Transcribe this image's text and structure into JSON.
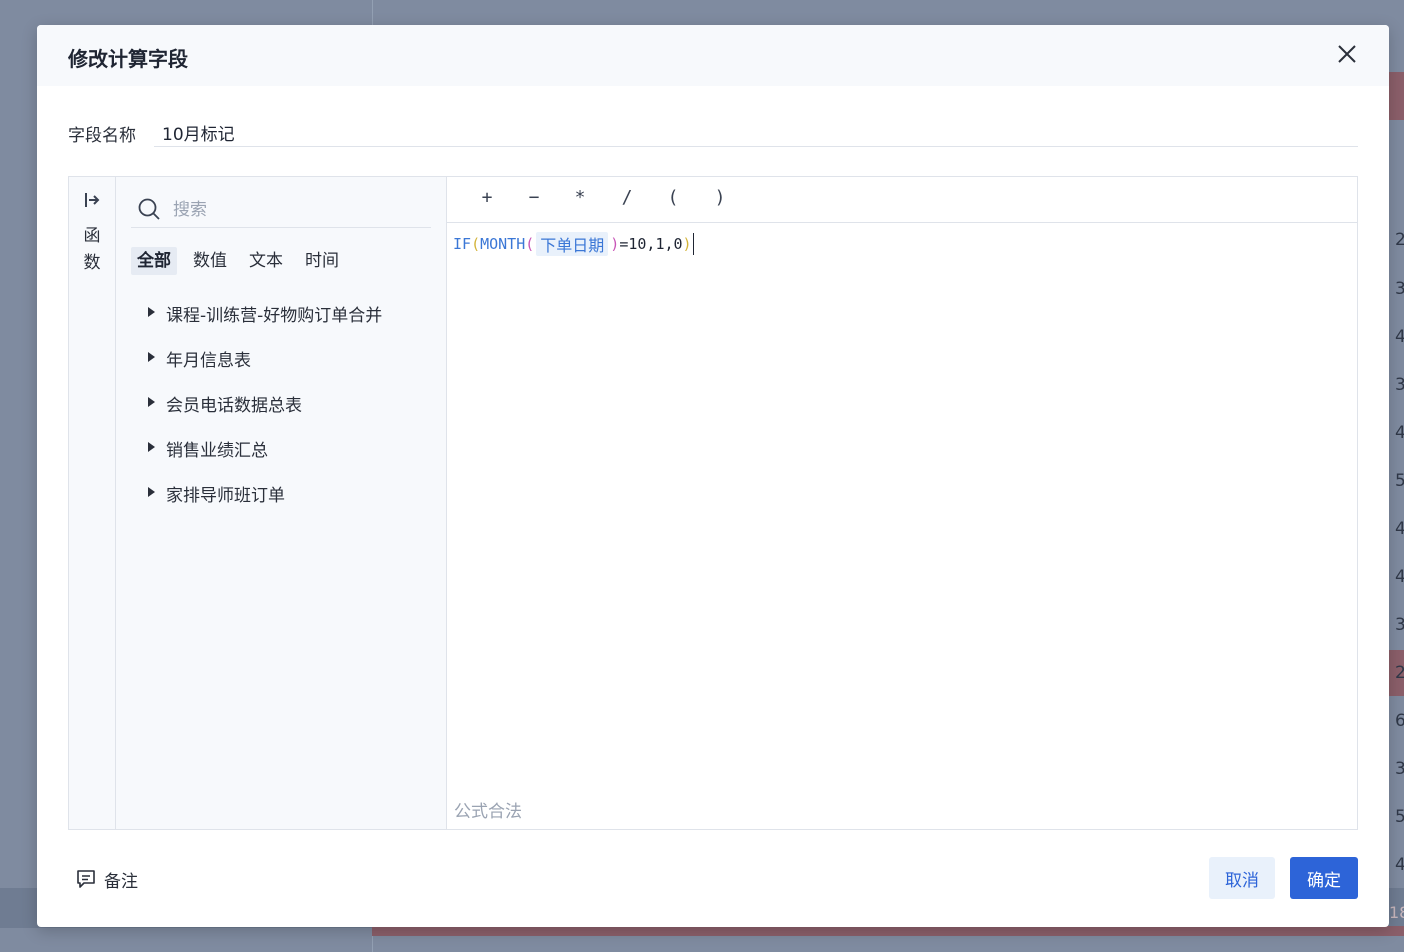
{
  "background": {
    "right_numbers": [
      "2",
      "3",
      "4",
      "3",
      "4",
      "5",
      "4",
      "4",
      "3",
      "2",
      "6",
      "3",
      "5",
      "4",
      "18"
    ]
  },
  "dialog": {
    "title": "修改计算字段",
    "field": {
      "label": "字段名称",
      "value": "10月标记"
    },
    "sidebar": {
      "tab_label": "函数"
    },
    "functions": {
      "search_placeholder": "搜索",
      "categories": [
        "全部",
        "数值",
        "文本",
        "时间"
      ],
      "active_category": "全部",
      "tables": [
        "课程-训练营-好物购订单合并",
        "年月信息表",
        "会员电话数据总表",
        "销售业绩汇总",
        "家排导师班订单"
      ]
    },
    "editor": {
      "operators": [
        "+",
        "−",
        "*",
        "/",
        "(",
        ")"
      ],
      "formula": {
        "fn_if": "IF",
        "open1": "(",
        "fn_month": "MONTH",
        "open2": "(",
        "field_ref": "下单日期",
        "close2": ")",
        "rest": "=10,1,0",
        "close1": ")"
      },
      "status": "公式合法"
    },
    "footer": {
      "note_label": "备注",
      "cancel_label": "取消",
      "ok_label": "确定"
    }
  },
  "colors": {
    "primary": "#2d64d8",
    "function": "#3b77d6",
    "paren_outer": "#d4b43a",
    "paren_inner": "#c957b8"
  }
}
